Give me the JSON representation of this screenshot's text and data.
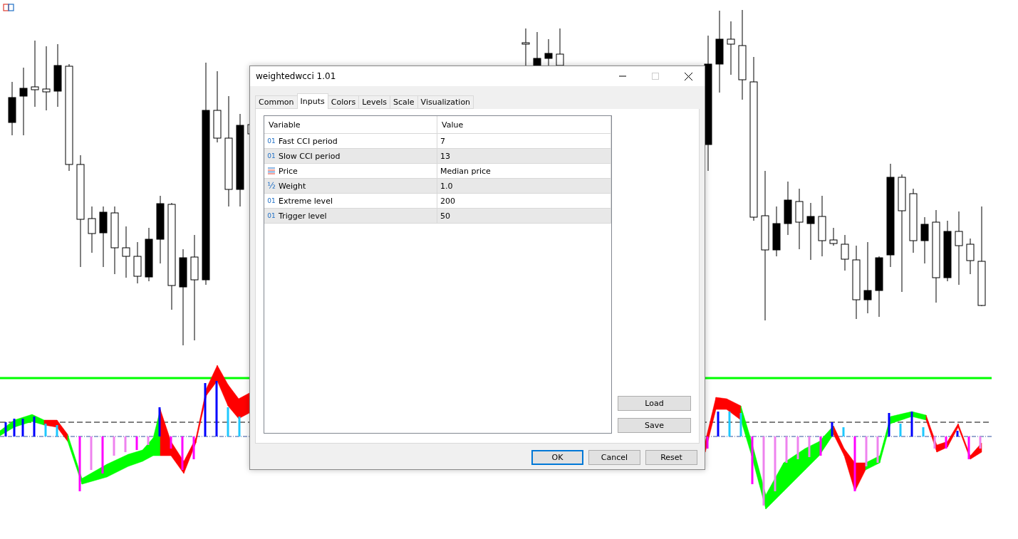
{
  "dialog": {
    "title": "weightedwcci 1.01",
    "tabs": [
      {
        "label": "Common",
        "selected": false
      },
      {
        "label": "Inputs",
        "selected": true
      },
      {
        "label": "Colors",
        "selected": false
      },
      {
        "label": "Levels",
        "selected": false
      },
      {
        "label": "Scale",
        "selected": false
      },
      {
        "label": "Visualization",
        "selected": false
      }
    ],
    "table": {
      "columns": [
        "Variable",
        "Value"
      ],
      "rows": [
        {
          "kind": "int",
          "icon": "01",
          "variable": "Fast CCI period",
          "value": "7"
        },
        {
          "kind": "int",
          "icon": "01",
          "variable": "Slow CCI period",
          "value": "13"
        },
        {
          "kind": "enum",
          "variable": "Price",
          "value": "Median price"
        },
        {
          "kind": "double",
          "icon": "½",
          "variable": "Weight",
          "value": "1.0"
        },
        {
          "kind": "int",
          "icon": "01",
          "variable": "Extreme level",
          "value": "200"
        },
        {
          "kind": "int",
          "icon": "01",
          "variable": "Trigger level",
          "value": "50"
        }
      ]
    },
    "side_buttons": [
      "Load",
      "Save"
    ],
    "buttons": [
      {
        "label": "OK",
        "default": true
      },
      {
        "label": "Cancel",
        "default": false
      },
      {
        "label": "Reset",
        "default": false
      }
    ]
  }
}
